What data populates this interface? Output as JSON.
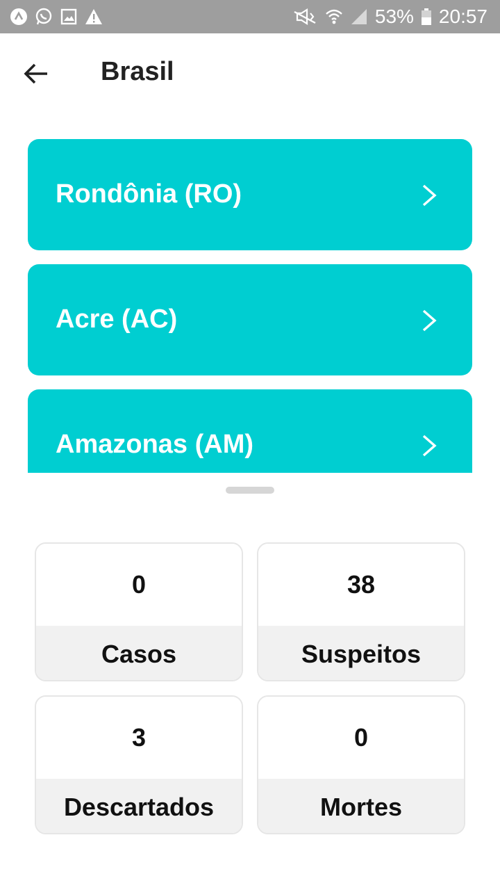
{
  "status_bar": {
    "battery": "53%",
    "time": "20:57",
    "left_icons": [
      "app-a-icon",
      "whatsapp-icon",
      "gallery-icon",
      "warning-icon"
    ],
    "right_icons": [
      "mute-icon",
      "wifi-icon",
      "signal-icon",
      "battery-icon"
    ]
  },
  "app_bar": {
    "title": "Brasil",
    "back_icon": "arrow-left-icon"
  },
  "states": [
    {
      "label": "Rondônia (RO)"
    },
    {
      "label": "Acre (AC)"
    },
    {
      "label": "Amazonas (AM)"
    }
  ],
  "stats": [
    {
      "value": "0",
      "label": "Casos"
    },
    {
      "value": "38",
      "label": "Suspeitos"
    },
    {
      "value": "3",
      "label": "Descartados"
    },
    {
      "value": "0",
      "label": "Mortes"
    }
  ],
  "colors": {
    "accent": "#00ced1",
    "status_bar": "#9e9e9e",
    "stat_footer": "#f1f1f1"
  }
}
